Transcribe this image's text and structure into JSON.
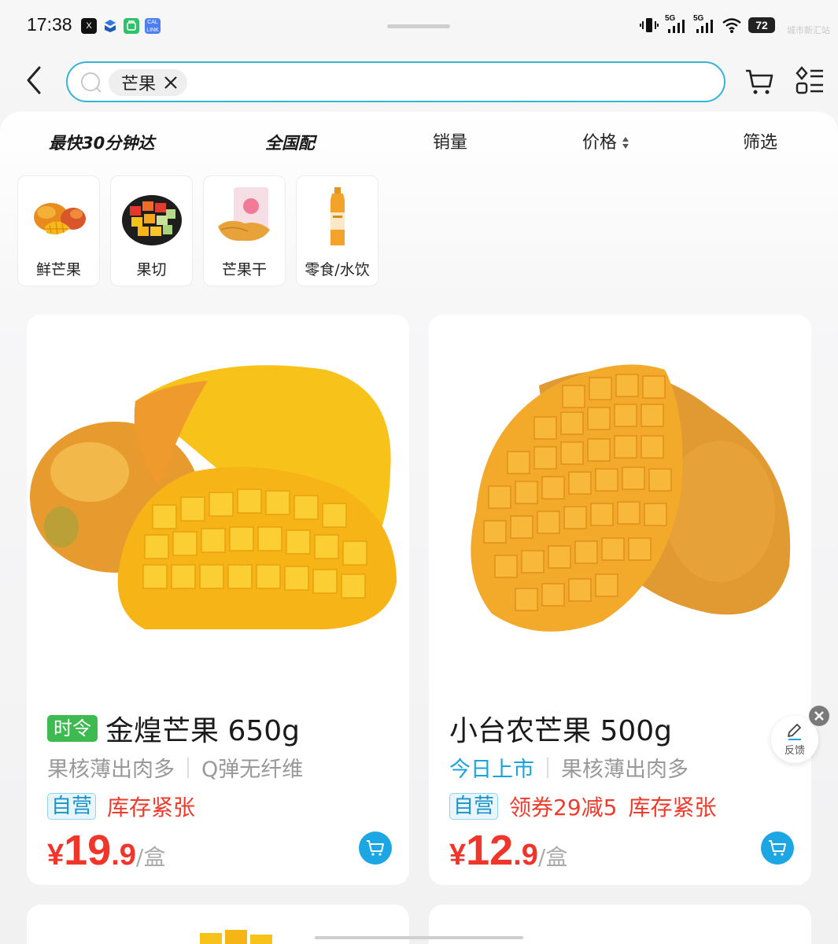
{
  "status_bar": {
    "time": "17:38",
    "signal_1": "5G",
    "signal_2": "5G",
    "battery": "72",
    "carrier_text": "城市新汇站"
  },
  "search": {
    "query_chip": "芒果"
  },
  "filters": [
    {
      "label": "最快30分钟达"
    },
    {
      "label": "全国配"
    },
    {
      "label": "销量"
    },
    {
      "label": "价格"
    },
    {
      "label": "筛选"
    }
  ],
  "categories": [
    {
      "label": "鲜芒果",
      "icon": "mango-fruit-icon"
    },
    {
      "label": "果切",
      "icon": "fruit-platter-icon"
    },
    {
      "label": "芒果干",
      "icon": "dried-mango-icon"
    },
    {
      "label": "零食/水饮",
      "icon": "juice-bottle-icon"
    }
  ],
  "products": [
    {
      "badge": "时令",
      "title": "金煌芒果 650g",
      "tags": [
        "果核薄出肉多",
        "Q弹无纤维"
      ],
      "self_label": "自营",
      "promos": [
        "库存紧张"
      ],
      "price_symbol": "¥",
      "price_int": "19",
      "price_dec": ".9",
      "unit": "/盒"
    },
    {
      "badge": "",
      "title": "小台农芒果 500g",
      "tags": [
        "今日上市",
        "果核薄出肉多"
      ],
      "self_label": "自营",
      "promos": [
        "领券29减5",
        "库存紧张"
      ],
      "price_symbol": "¥",
      "price_int": "12",
      "price_dec": ".9",
      "unit": "/盒"
    }
  ],
  "feedback": {
    "label": "反馈"
  },
  "colors": {
    "accent_blue": "#1ca6e4",
    "price_red": "#f0352a",
    "season_green": "#3dbb50",
    "search_border": "#37b3da"
  }
}
